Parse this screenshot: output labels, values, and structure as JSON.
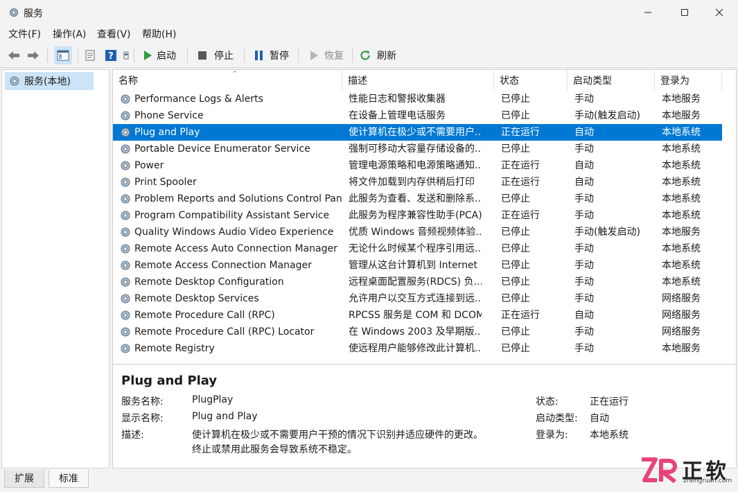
{
  "window": {
    "title": "服务"
  },
  "menu": [
    "文件(F)",
    "操作(A)",
    "查看(V)",
    "帮助(H)"
  ],
  "toolbar": {
    "start_label": "启动",
    "stop_label": "停止",
    "pause_label": "暂停",
    "resume_label": "恢复",
    "refresh_label": "刷新"
  },
  "tree": {
    "root_label": "服务(本地)"
  },
  "columns": {
    "name": "名称",
    "desc": "描述",
    "status": "状态",
    "startup": "启动类型",
    "logon": "登录为"
  },
  "services": [
    {
      "name": "Performance Logs & Alerts",
      "desc": "性能日志和警报收集器",
      "status": "已停止",
      "startup": "手动",
      "logon": "本地服务"
    },
    {
      "name": "Phone Service",
      "desc": "在设备上管理电话服务",
      "status": "已停止",
      "startup": "手动(触发启动)",
      "logon": "本地服务"
    },
    {
      "name": "Plug and Play",
      "desc": "使计算机在极少或不需要用户...",
      "status": "正在运行",
      "startup": "自动",
      "logon": "本地系统"
    },
    {
      "name": "Portable Device Enumerator Service",
      "desc": "强制可移动大容量存储设备的...",
      "status": "已停止",
      "startup": "手动",
      "logon": "本地系统"
    },
    {
      "name": "Power",
      "desc": "管理电源策略和电源策略通知...",
      "status": "正在运行",
      "startup": "自动",
      "logon": "本地系统"
    },
    {
      "name": "Print Spooler",
      "desc": "将文件加载到内存供稍后打印",
      "status": "正在运行",
      "startup": "自动",
      "logon": "本地系统"
    },
    {
      "name": "Problem Reports and Solutions Control Panel ...",
      "desc": "此服务为查看、发送和删除系...",
      "status": "已停止",
      "startup": "手动",
      "logon": "本地系统"
    },
    {
      "name": "Program Compatibility Assistant Service",
      "desc": "此服务为程序兼容性助手(PCA)...",
      "status": "正在运行",
      "startup": "手动",
      "logon": "本地系统"
    },
    {
      "name": "Quality Windows Audio Video Experience",
      "desc": "优质 Windows 音频视频体验...",
      "status": "已停止",
      "startup": "手动(触发启动)",
      "logon": "本地服务"
    },
    {
      "name": "Remote Access Auto Connection Manager",
      "desc": "无论什么时候某个程序引用远...",
      "status": "已停止",
      "startup": "手动",
      "logon": "本地系统"
    },
    {
      "name": "Remote Access Connection Manager",
      "desc": "管理从这台计算机到 Internet ...",
      "status": "已停止",
      "startup": "手动",
      "logon": "本地系统"
    },
    {
      "name": "Remote Desktop Configuration",
      "desc": "远程桌面配置服务(RDCS) 负...",
      "status": "已停止",
      "startup": "手动",
      "logon": "本地系统"
    },
    {
      "name": "Remote Desktop Services",
      "desc": "允许用户以交互方式连接到远...",
      "status": "已停止",
      "startup": "手动",
      "logon": "网络服务"
    },
    {
      "name": "Remote Procedure Call (RPC)",
      "desc": "RPCSS 服务是 COM 和 DCOM...",
      "status": "正在运行",
      "startup": "自动",
      "logon": "网络服务"
    },
    {
      "name": "Remote Procedure Call (RPC) Locator",
      "desc": "在 Windows 2003 及早期版...",
      "status": "已停止",
      "startup": "手动",
      "logon": "网络服务"
    },
    {
      "name": "Remote Registry",
      "desc": "使远程用户能够修改此计算机...",
      "status": "已停止",
      "startup": "手动",
      "logon": "本地服务"
    }
  ],
  "selected_index": 2,
  "details": {
    "title": "Plug and Play",
    "service_name_label": "服务名称:",
    "service_name": "PlugPlay",
    "display_name_label": "显示名称:",
    "display_name": "Plug and Play",
    "description_label": "描述:",
    "description_line1": "使计算机在极少或不需要用户干预的情况下识别并适应硬件的更改。",
    "description_line2": "终止或禁用此服务会导致系统不稳定。",
    "status_label": "状态:",
    "status": "正在运行",
    "startup_label": "启动类型:",
    "startup": "自动",
    "logon_label": "登录为:",
    "logon": "本地系统"
  },
  "tabs": {
    "extended": "扩展",
    "standard": "标准"
  },
  "watermark": {
    "brand": "正软",
    "domain": "zhengruan.com",
    "accent": "#e8437b"
  }
}
